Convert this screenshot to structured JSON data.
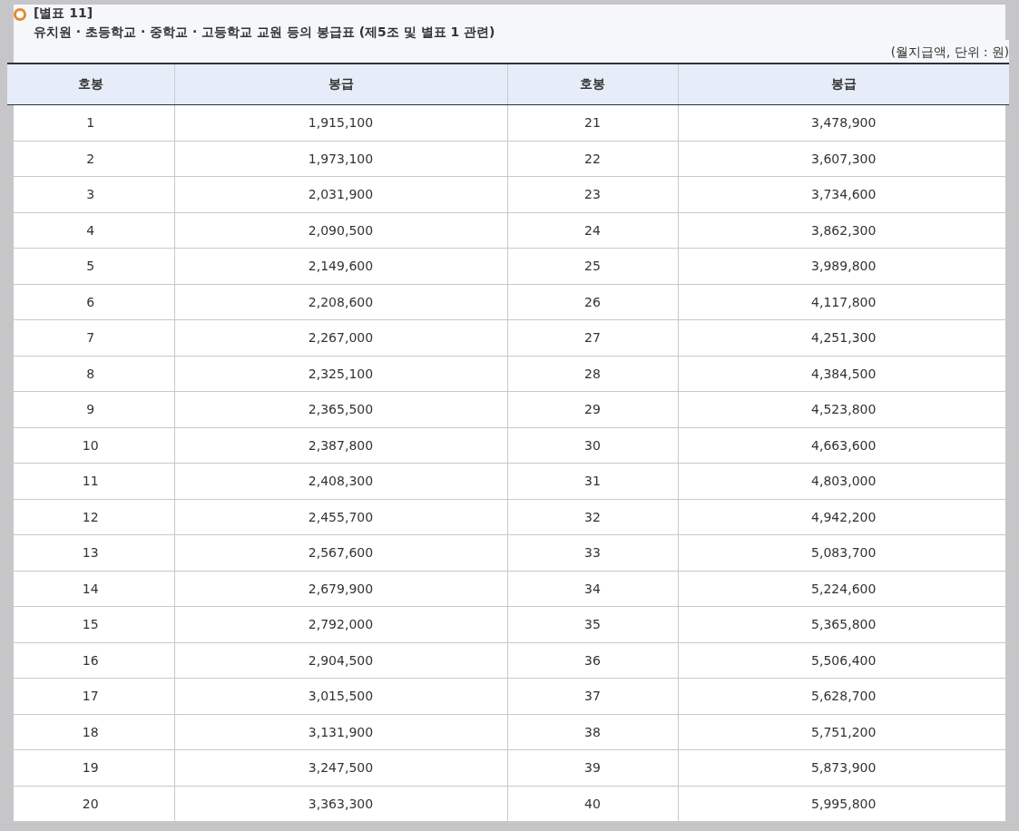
{
  "heading": {
    "label": "[별표 11]",
    "title": "유치원 · 초등학교 · 중학교 · 고등학교 교원 등의 봉급표 (제5조 및 별표 1 관련)"
  },
  "unit_note": "(월지급액, 단위 : 원)",
  "table": {
    "columns": [
      "호봉",
      "봉급",
      "호봉",
      "봉급"
    ],
    "rows": [
      [
        "1",
        "1,915,100",
        "21",
        "3,478,900"
      ],
      [
        "2",
        "1,973,100",
        "22",
        "3,607,300"
      ],
      [
        "3",
        "2,031,900",
        "23",
        "3,734,600"
      ],
      [
        "4",
        "2,090,500",
        "24",
        "3,862,300"
      ],
      [
        "5",
        "2,149,600",
        "25",
        "3,989,800"
      ],
      [
        "6",
        "2,208,600",
        "26",
        "4,117,800"
      ],
      [
        "7",
        "2,267,000",
        "27",
        "4,251,300"
      ],
      [
        "8",
        "2,325,100",
        "28",
        "4,384,500"
      ],
      [
        "9",
        "2,365,500",
        "29",
        "4,523,800"
      ],
      [
        "10",
        "2,387,800",
        "30",
        "4,663,600"
      ],
      [
        "11",
        "2,408,300",
        "31",
        "4,803,000"
      ],
      [
        "12",
        "2,455,700",
        "32",
        "4,942,200"
      ],
      [
        "13",
        "2,567,600",
        "33",
        "5,083,700"
      ],
      [
        "14",
        "2,679,900",
        "34",
        "5,224,600"
      ],
      [
        "15",
        "2,792,000",
        "35",
        "5,365,800"
      ],
      [
        "16",
        "2,904,500",
        "36",
        "5,506,400"
      ],
      [
        "17",
        "3,015,500",
        "37",
        "5,628,700"
      ],
      [
        "18",
        "3,131,900",
        "38",
        "5,751,200"
      ],
      [
        "19",
        "3,247,500",
        "39",
        "5,873,900"
      ],
      [
        "20",
        "3,363,300",
        "40",
        "5,995,800"
      ]
    ]
  }
}
